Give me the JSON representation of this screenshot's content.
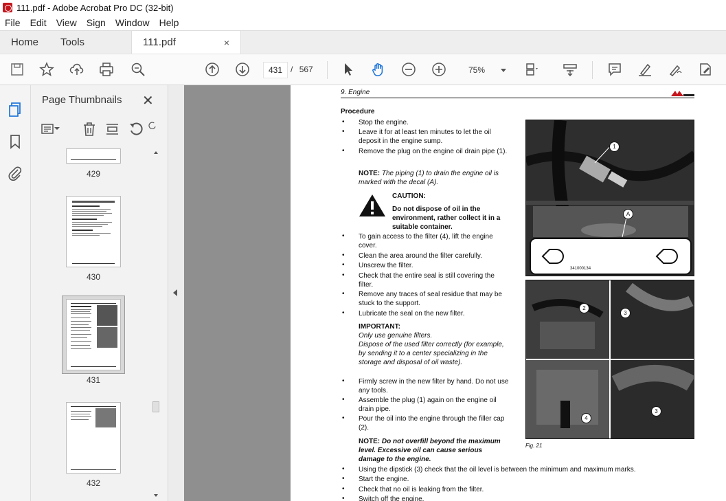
{
  "window": {
    "title": "111.pdf - Adobe Acrobat Pro DC (32-bit)"
  },
  "menu": [
    "File",
    "Edit",
    "View",
    "Sign",
    "Window",
    "Help"
  ],
  "tabs": {
    "home": "Home",
    "tools": "Tools",
    "document": "111.pdf",
    "close": "×"
  },
  "toolbar": {
    "current_page": "431",
    "page_separator": "/",
    "total_pages": "567",
    "zoom": "75%"
  },
  "panel": {
    "title": "Page Thumbnails",
    "close": "✕",
    "thumbnails": [
      "429",
      "430",
      "431",
      "432"
    ],
    "selected": "431"
  },
  "document": {
    "header": "9. Engine",
    "procedure_heading": "Procedure",
    "steps_a": [
      "Stop the engine.",
      "Leave it for at least ten minutes to let the oil deposit in the engine sump.",
      "Remove the plug on the engine oil drain pipe (1)."
    ],
    "note1_label": "NOTE:",
    "note1_text": "The piping (1) to drain the engine oil is marked with the decal (A).",
    "caution_label": "CAUTION:",
    "caution_text": "Do not dispose of oil in the environment, rather collect it in a suitable container.",
    "steps_b": [
      "To gain access to the filter (4), lift the engine cover.",
      "Clean the area around the filter carefully.",
      "Unscrew the filter.",
      "Check that the entire seal is still covering the filter.",
      "Remove any traces of seal residue that may be stuck to the support.",
      "Lubricate the seal on the new filter."
    ],
    "important_label": "IMPORTANT:",
    "important_line1": "Only use genuine filters.",
    "important_line2": "Dispose of the used filter correctly (for example, by sending it to a center specializing in the storage and disposal of oil waste).",
    "steps_c": [
      "Firmly screw in the new filter by hand. Do not use any tools.",
      "Assemble the plug (1) again on the engine oil drain pipe.",
      "Pour the oil into the engine through the filler cap (2)."
    ],
    "note2_label": "NOTE:",
    "note2_text": "Do not overfill beyond the maximum level. Excessive oil can cause serious damage to the engine.",
    "steps_d": [
      "Using the dipstick (3) check that the oil level is between the minimum and maximum marks.",
      "Start the engine.",
      "Check that no oil is leaking from the filter.",
      "Switch off the engine."
    ],
    "figure_code": "341000134",
    "figure_caption": "Fig. 21",
    "callouts": [
      "1",
      "A",
      "2",
      "3",
      "4",
      "3"
    ]
  },
  "colors": {
    "accent": "#c4161c",
    "viewer_bg": "#8f8f8f",
    "panel_bg": "#f2f2f2"
  }
}
